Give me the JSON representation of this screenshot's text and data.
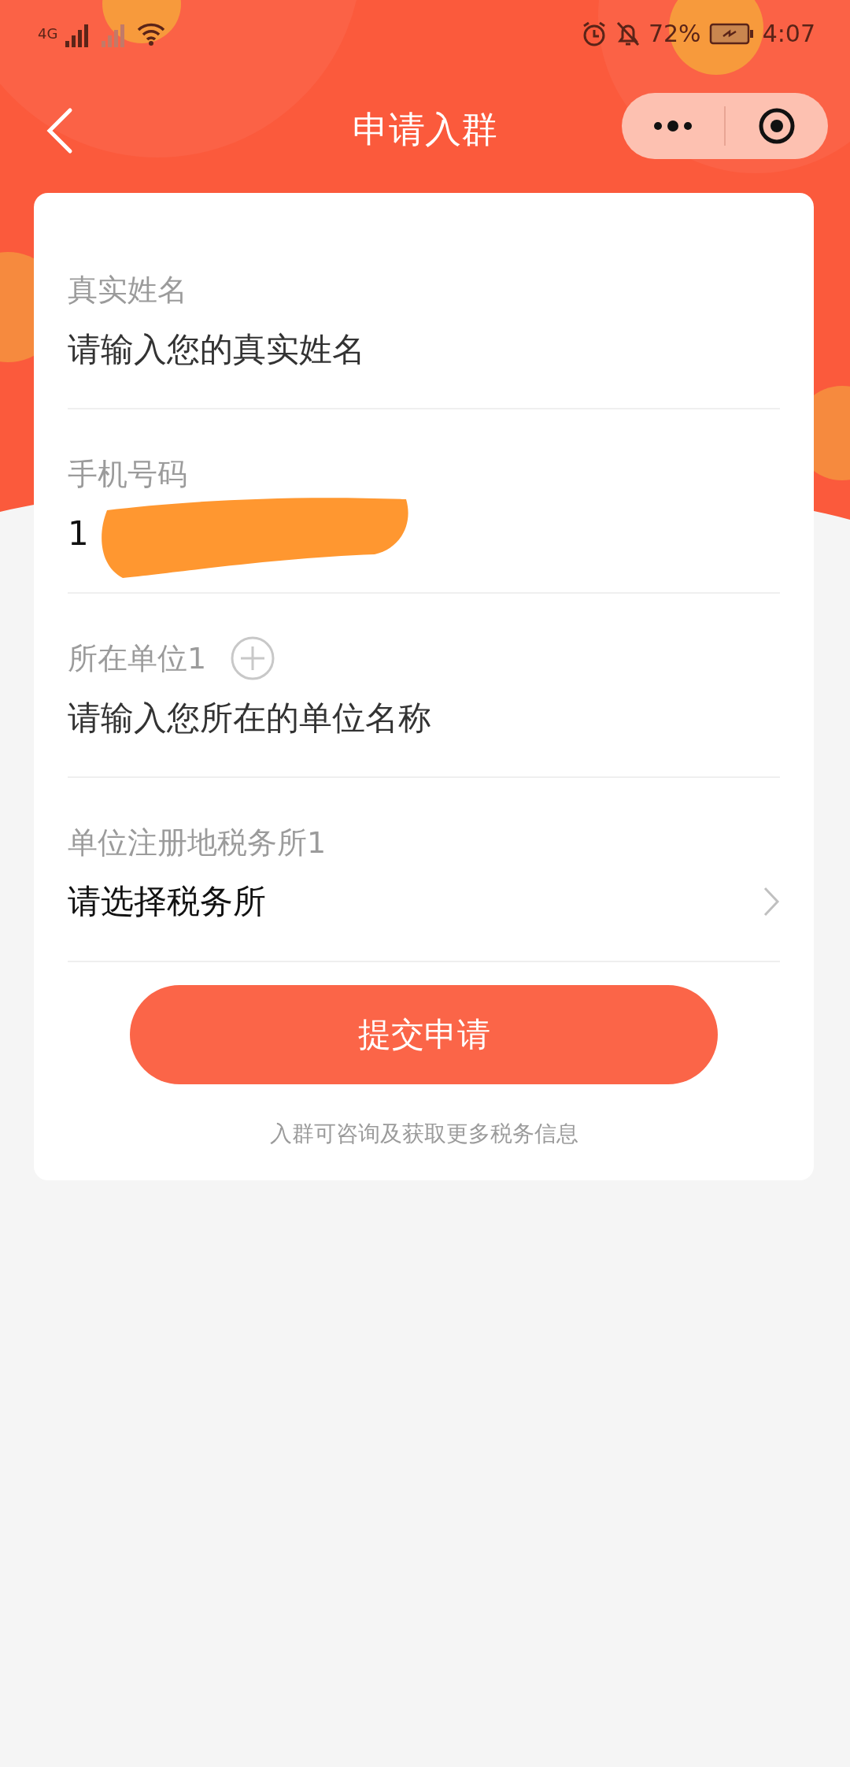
{
  "status_bar": {
    "network": "4G",
    "battery_percent": "72%",
    "time": "4:07"
  },
  "nav_bar": {
    "title": "申请入群"
  },
  "form": {
    "fields": [
      {
        "kind": "input",
        "label": "真实姓名",
        "placeholder": "请输入您的真实姓名"
      },
      {
        "kind": "input",
        "label": "手机号码",
        "value": "1",
        "redacted": true
      },
      {
        "kind": "input",
        "label": "所在单位1",
        "placeholder": "请输入您所在的单位名称",
        "addable": true
      },
      {
        "kind": "select",
        "label": "单位注册地税务所1",
        "placeholder": "请选择税务所"
      }
    ],
    "submit": "提交申请",
    "note": "入群可咨询及获取更多税务信息"
  }
}
